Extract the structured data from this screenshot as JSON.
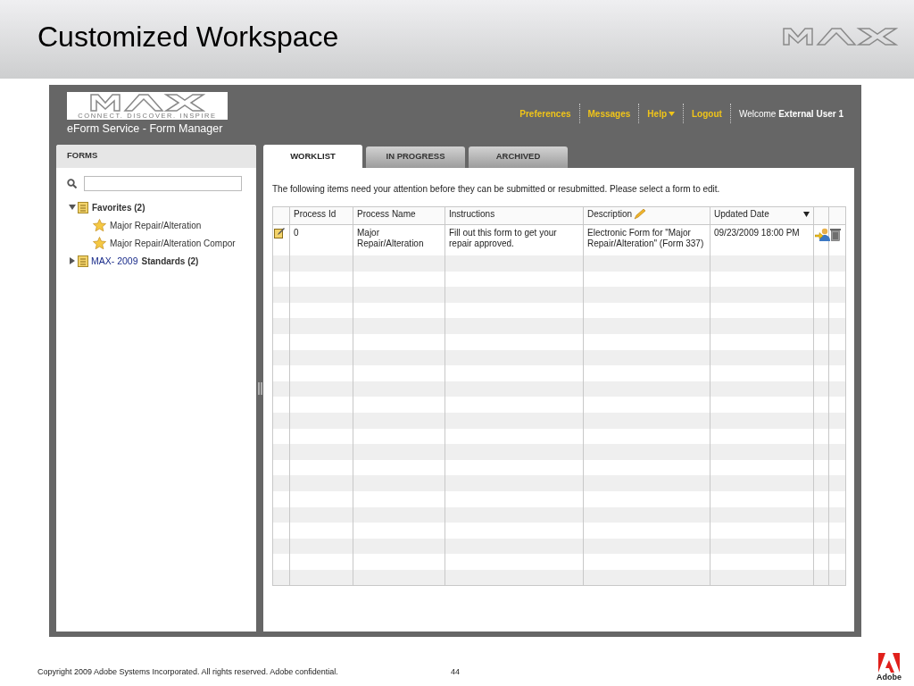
{
  "slide": {
    "title": "Customized Workspace",
    "footer": "Copyright 2009 Adobe Systems Incorporated.  All rights reserved.  Adobe confidential.",
    "page_number": "44",
    "brand": "Adobe"
  },
  "app": {
    "tagline": "CONNECT. DISCOVER. INSPIRE",
    "title": "eForm Service - Form Manager",
    "nav": [
      {
        "label": "Preferences",
        "dropdown": false
      },
      {
        "label": "Messages",
        "dropdown": false
      },
      {
        "label": "Help",
        "dropdown": true
      },
      {
        "label": "Logout",
        "dropdown": false
      }
    ],
    "welcome": "Welcome **External User 1**"
  },
  "forms_panel": {
    "title": "FORMS",
    "tree": [
      {
        "label": "Favorites (2)",
        "expanded": true,
        "children": [
          {
            "label": "Major Repair/Alteration"
          },
          {
            "label": "Major Repair/Alteration Compor"
          }
        ]
      },
      {
        "prefix": "MAX- 2009",
        "label": "Standards (2)",
        "expanded": false
      }
    ]
  },
  "tabs": [
    {
      "label": "WORKLIST",
      "selected": true
    },
    {
      "label": "IN PROGRESS",
      "selected": false
    },
    {
      "label": "ARCHIVED",
      "selected": false
    }
  ],
  "message": "The following items need your attention before they can be submitted or resubmitted.  Please select a form to edit.",
  "table": {
    "columns": [
      {
        "label": "Process Id",
        "editable": false,
        "sorted": false
      },
      {
        "label": "Process Name",
        "editable": false,
        "sorted": false
      },
      {
        "label": "Instructions",
        "editable": false,
        "sorted": false
      },
      {
        "label": "Description",
        "editable": true,
        "sorted": false
      },
      {
        "label": "Updated Date",
        "editable": false,
        "sorted": true
      }
    ],
    "rows": [
      {
        "cells": [
          "0",
          "Major Repair/Alteration",
          "Fill out this form to get your repair approved.",
          "Electronic Form for \"Major Repair/Alteration\" (Form 337)",
          "09/23/2009 18:00 PM"
        ]
      }
    ]
  }
}
